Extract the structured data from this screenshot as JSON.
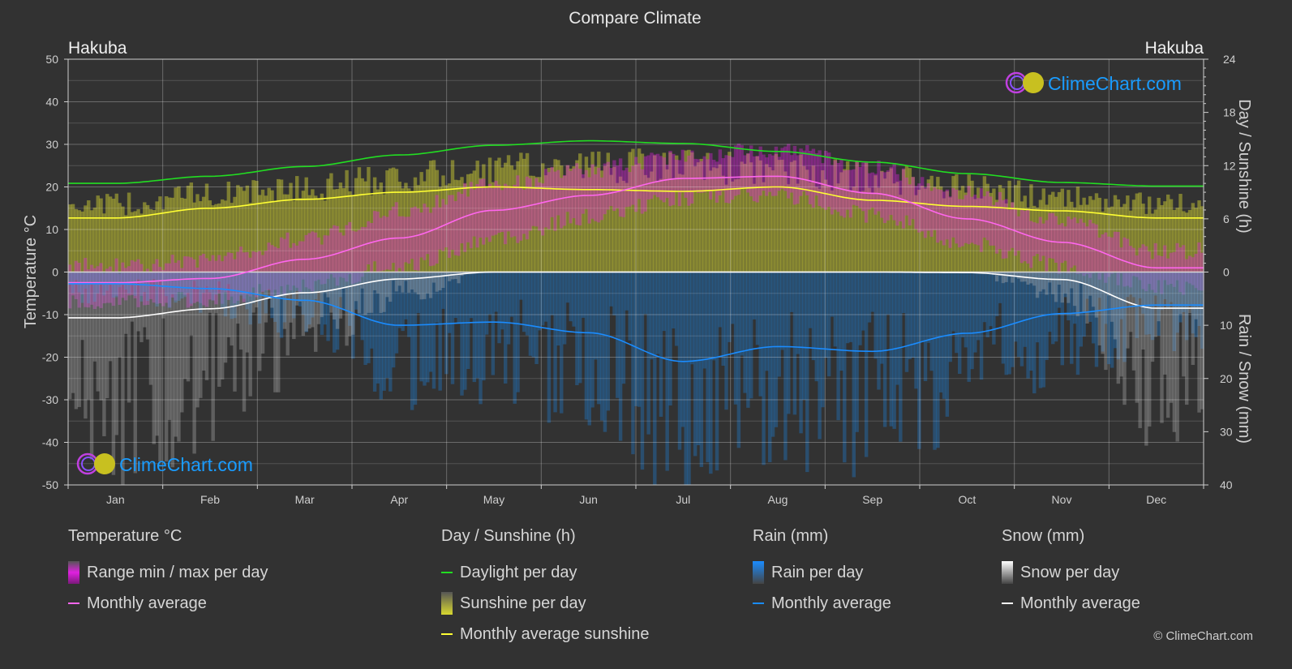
{
  "title": "Compare Climate",
  "location_left": "Hakuba",
  "location_right": "Hakuba",
  "watermark": "ClimeChart.com",
  "copyright": "© ClimeChart.com",
  "colors": {
    "background": "#323232",
    "temp_range": "#e020e0",
    "temp_avg": "#ff66ee",
    "daylight": "#22dd22",
    "sunshine_bar": "#c8c832",
    "sunshine_avg": "#ffff33",
    "rain_bar": "#1e78c8",
    "rain_avg": "#1a8cff",
    "snow_bar": "#b4b4b4",
    "snow_avg": "#ffffff",
    "brand_blue": "#1a9cff"
  },
  "chart_data": {
    "type": "line",
    "title": "Compare Climate",
    "categories": [
      "Jan",
      "Feb",
      "Mar",
      "Apr",
      "May",
      "Jun",
      "Jul",
      "Aug",
      "Sep",
      "Oct",
      "Nov",
      "Dec"
    ],
    "axes": {
      "left": {
        "label": "Temperature °C",
        "range": [
          -50,
          50
        ],
        "ticks": [
          50,
          40,
          30,
          20,
          10,
          0,
          -10,
          -20,
          -30,
          -40,
          -50
        ]
      },
      "right_top": {
        "label": "Day / Sunshine (h)",
        "range": [
          0,
          24
        ],
        "ticks": [
          24,
          18,
          12,
          6,
          0
        ]
      },
      "right_bottom": {
        "label": "Rain / Snow (mm)",
        "range": [
          0,
          40
        ],
        "ticks": [
          0,
          10,
          20,
          30,
          40
        ]
      }
    },
    "grid": true,
    "series": [
      {
        "name": "Temperature monthly average",
        "axis": "left",
        "unit": "°C",
        "values": [
          -2.5,
          -1.5,
          3.0,
          8.0,
          14.5,
          18.0,
          22.0,
          22.5,
          18.5,
          12.5,
          7.0,
          1.0
        ]
      },
      {
        "name": "Temperature daily max (approx)",
        "axis": "left",
        "unit": "°C",
        "values": [
          1.5,
          3.0,
          8.0,
          14.5,
          20.5,
          24.0,
          27.5,
          29.0,
          24.5,
          18.5,
          12.0,
          5.0
        ]
      },
      {
        "name": "Temperature daily min (approx)",
        "axis": "left",
        "unit": "°C",
        "values": [
          -7.0,
          -6.5,
          -3.0,
          1.5,
          8.0,
          13.0,
          17.5,
          18.0,
          13.5,
          6.5,
          1.5,
          -3.5
        ]
      },
      {
        "name": "Daylight per day",
        "axis": "right_top",
        "unit": "h",
        "values": [
          10.0,
          10.8,
          11.9,
          13.2,
          14.3,
          14.8,
          14.5,
          13.6,
          12.4,
          11.1,
          10.1,
          9.7
        ]
      },
      {
        "name": "Sunshine per day (approx max)",
        "axis": "right_top",
        "unit": "h",
        "values": [
          8.5,
          9.8,
          10.5,
          11.8,
          12.8,
          13.4,
          13.2,
          12.8,
          11.8,
          10.5,
          9.3,
          8.5
        ]
      },
      {
        "name": "Monthly average sunshine",
        "axis": "right_top",
        "unit": "h",
        "values": [
          6.1,
          7.2,
          8.2,
          9.0,
          9.6,
          9.3,
          9.1,
          9.6,
          8.1,
          7.4,
          6.9,
          6.1
        ]
      },
      {
        "name": "Rain monthly average",
        "axis": "right_bottom",
        "unit": "mm",
        "values": [
          2.2,
          3.1,
          5.3,
          10.0,
          9.4,
          11.4,
          16.8,
          14.0,
          14.9,
          11.5,
          7.8,
          6.2
        ]
      },
      {
        "name": "Snow monthly average",
        "axis": "right_bottom",
        "unit": "mm",
        "values": [
          8.6,
          6.9,
          3.9,
          1.3,
          0.0,
          0.0,
          0.0,
          0.0,
          0.0,
          0.1,
          1.4,
          6.8
        ]
      }
    ]
  },
  "legend": {
    "groups": [
      {
        "title": "Temperature °C",
        "items": [
          {
            "type": "bar",
            "label": "Range min / max per day",
            "color": "#e020e0"
          },
          {
            "type": "line",
            "label": "Monthly average",
            "color": "#ff66ee"
          }
        ]
      },
      {
        "title": "Day / Sunshine (h)",
        "items": [
          {
            "type": "line",
            "label": "Daylight per day",
            "color": "#22dd22"
          },
          {
            "type": "bar",
            "label": "Sunshine per day",
            "color": "#d8d830"
          },
          {
            "type": "line",
            "label": "Monthly average sunshine",
            "color": "#ffff33"
          }
        ]
      },
      {
        "title": "Rain (mm)",
        "items": [
          {
            "type": "bar",
            "label": "Rain per day",
            "color": "#1a8cff"
          },
          {
            "type": "line",
            "label": "Monthly average",
            "color": "#1a8cff"
          }
        ]
      },
      {
        "title": "Snow (mm)",
        "items": [
          {
            "type": "bar",
            "label": "Snow per day",
            "color": "#ffffff"
          },
          {
            "type": "line",
            "label": "Monthly average",
            "color": "#ffffff"
          }
        ]
      }
    ]
  }
}
